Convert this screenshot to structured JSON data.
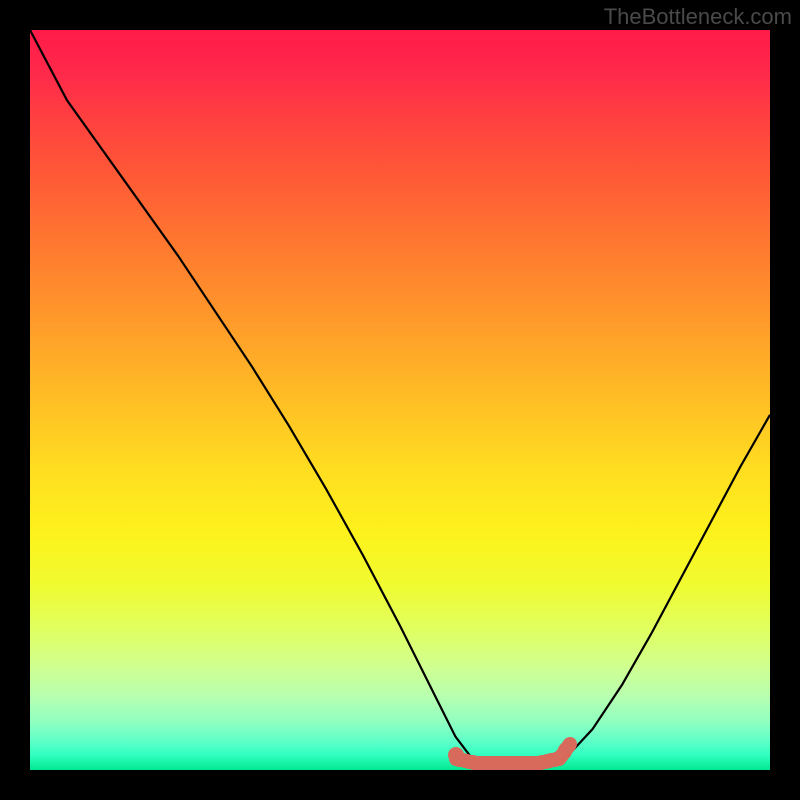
{
  "watermark": "TheBottleneck.com",
  "colors": {
    "frame": "#000000",
    "curve": "#000000",
    "marker": "#d86a5c",
    "gradient_top": "#ff1a4a",
    "gradient_bottom": "#00e890"
  },
  "chart_data": {
    "type": "line",
    "title": "",
    "xlabel": "",
    "ylabel": "",
    "xlim": [
      0,
      1
    ],
    "ylim": [
      0,
      1
    ],
    "curve": {
      "x": [
        0.0,
        0.05,
        0.1,
        0.15,
        0.2,
        0.25,
        0.3,
        0.35,
        0.4,
        0.45,
        0.5,
        0.55,
        0.575,
        0.6,
        0.63,
        0.67,
        0.7,
        0.72,
        0.76,
        0.8,
        0.84,
        0.88,
        0.92,
        0.96,
        1.0
      ],
      "y": [
        1.0,
        0.905,
        0.835,
        0.765,
        0.695,
        0.62,
        0.545,
        0.465,
        0.38,
        0.29,
        0.195,
        0.095,
        0.045,
        0.012,
        0.003,
        0.003,
        0.005,
        0.012,
        0.055,
        0.115,
        0.185,
        0.26,
        0.335,
        0.41,
        0.48
      ]
    },
    "highlight_segment": {
      "x": [
        0.575,
        0.6,
        0.63,
        0.66,
        0.69,
        0.715,
        0.73
      ],
      "y": [
        0.015,
        0.01,
        0.009,
        0.009,
        0.01,
        0.015,
        0.035
      ]
    },
    "highlight_point": {
      "x": 0.575,
      "y": 0.02
    }
  }
}
